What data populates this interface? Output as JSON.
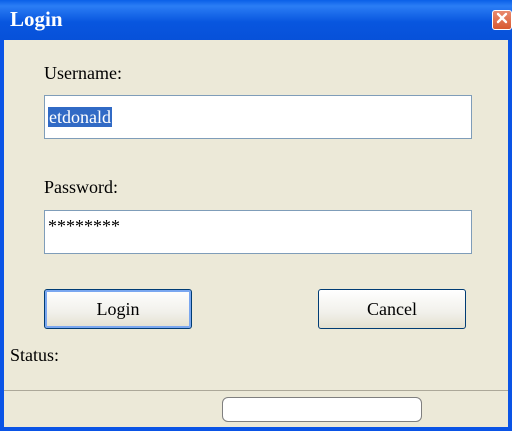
{
  "window": {
    "title": "Login"
  },
  "form": {
    "username_label": "Username:",
    "username_value": "etdonald",
    "password_label": "Password:",
    "password_value": "********"
  },
  "buttons": {
    "login_label": "Login",
    "cancel_label": "Cancel"
  },
  "status": {
    "label": "Status:",
    "value": ""
  },
  "icons": {
    "close": "close-icon"
  },
  "colors": {
    "titlebar": "#0a54e6",
    "selection": "#316ac5",
    "close_button": "#d8582f"
  }
}
